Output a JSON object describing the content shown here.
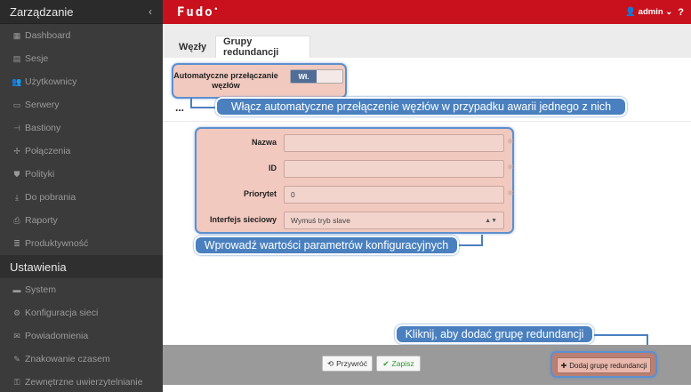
{
  "sidebar": {
    "header": "Zarządzanie",
    "collapse_glyph": "‹",
    "items_management": [
      {
        "icon": "dashboard-icon",
        "glyph": "▦",
        "label": "Dashboard"
      },
      {
        "icon": "sessions-icon",
        "glyph": "▤",
        "label": "Sesje"
      },
      {
        "icon": "users-icon",
        "glyph": "👥",
        "label": "Użytkownicy"
      },
      {
        "icon": "servers-icon",
        "glyph": "▭",
        "label": "Serwery"
      },
      {
        "icon": "bastions-icon",
        "glyph": "⊣",
        "label": "Bastiony"
      },
      {
        "icon": "connections-icon",
        "glyph": "✢",
        "label": "Połączenia"
      },
      {
        "icon": "policies-icon",
        "glyph": "⛊",
        "label": "Polityki"
      },
      {
        "icon": "downloads-icon",
        "glyph": "⤓",
        "label": "Do pobrania"
      },
      {
        "icon": "reports-icon",
        "glyph": "⎙",
        "label": "Raporty"
      },
      {
        "icon": "productivity-icon",
        "glyph": "≣",
        "label": "Produktywność"
      }
    ],
    "section_settings": "Ustawienia",
    "items_settings": [
      {
        "icon": "system-icon",
        "glyph": "▬",
        "label": "System"
      },
      {
        "icon": "network-config-icon",
        "glyph": "⚙",
        "label": "Konfiguracja sieci"
      },
      {
        "icon": "notifications-icon",
        "glyph": "✉",
        "label": "Powiadomienia"
      },
      {
        "icon": "timestamping-icon",
        "glyph": "✎",
        "label": "Znakowanie czasem"
      },
      {
        "icon": "external-auth-icon",
        "glyph": "⚿",
        "label": "Zewnętrzne uwierzytelnianie"
      }
    ]
  },
  "topbar": {
    "logo": "Fudo",
    "user": "admin",
    "user_glyph": "👤",
    "user_caret": "⌄",
    "help": "?"
  },
  "tabs": [
    {
      "label": "Węzły",
      "active": false
    },
    {
      "label": "Grupy redundancji",
      "active": true
    }
  ],
  "auto_switch": {
    "label": "Automatyczne przełączanie węzłów",
    "toggle_label": "Wł.",
    "state": "on"
  },
  "ellipsis": "...",
  "form": {
    "fields": [
      {
        "label": "Nazwa",
        "value": "",
        "required": true
      },
      {
        "label": "ID",
        "value": "",
        "required": true
      },
      {
        "label": "Priorytet",
        "value": "0",
        "required": true
      },
      {
        "label": "Interfejs sieciowy",
        "value": "Wymuś tryb slave",
        "type": "select"
      }
    ],
    "required_glyph": "✱"
  },
  "callouts": {
    "auto_switch": "Włącz automatyczne przełączenie węzłów w przypadku awarii jednego z nich",
    "form": "Wprowadź wartości parametrów konfiguracyjnych",
    "add_group": "Kliknij, aby dodać grupę redundancji"
  },
  "bottom": {
    "reset_label": "Przywróć",
    "reset_glyph": "⟲",
    "save_label": "Zapisz",
    "save_glyph": "✔",
    "add_label": "Dodaj grupę redundancji",
    "add_glyph": "✚"
  },
  "colors": {
    "topbar": "#c9111e",
    "sidebar": "#3b3b3b",
    "callout": "#4a80bf",
    "highlight": "#f1c9bf"
  }
}
